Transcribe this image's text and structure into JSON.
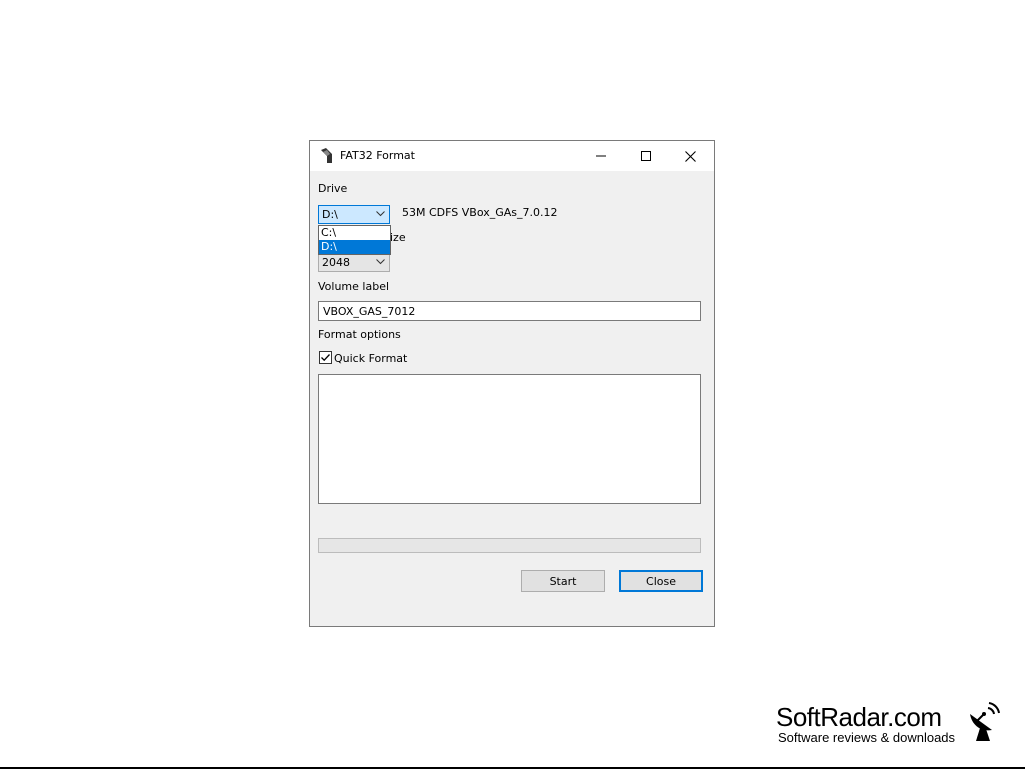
{
  "window": {
    "title": "FAT32 Format",
    "icon": "fat32-app-icon"
  },
  "drive": {
    "label": "Drive",
    "selected": "D:\\",
    "info": "53M CDFS VBox_GAs_7.0.12",
    "options": [
      "C:\\",
      "D:\\"
    ],
    "highlighted_index": 1
  },
  "allocation": {
    "label_visible": "ize",
    "value": "2048"
  },
  "volume_label": {
    "label": "Volume label",
    "value": "VBOX_GAS_7012"
  },
  "format_options": {
    "label": "Format options",
    "quick_format_label": "Quick Format",
    "quick_format_checked": true
  },
  "log": {
    "text": ""
  },
  "progress": {
    "value": 0
  },
  "buttons": {
    "start": "Start",
    "close": "Close"
  },
  "brand": {
    "name": "SoftRadar.com",
    "tagline": "Software reviews & downloads"
  },
  "colors": {
    "accent": "#0078d7",
    "window_bg": "#f0f0f0",
    "title_bg": "#ffffff"
  }
}
